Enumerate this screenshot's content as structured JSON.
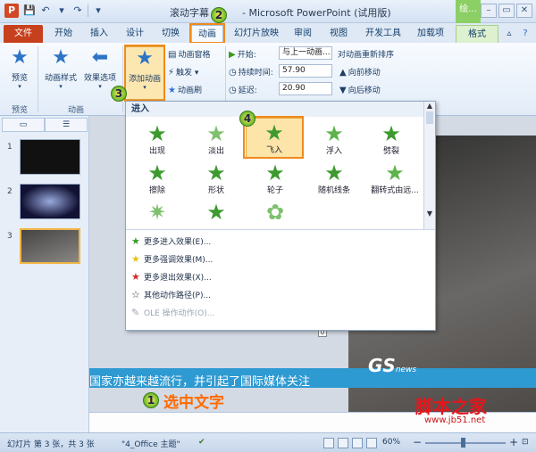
{
  "title_bar": {
    "file_name": "滚动字幕",
    "app_name": "- Microsoft PowerPoint (试用版)",
    "context_tab_group": "绘..."
  },
  "tabs": [
    "文件",
    "开始",
    "插入",
    "设计",
    "切换",
    "动画",
    "幻灯片放映",
    "审阅",
    "视图",
    "开发工具",
    "加载项",
    "格式"
  ],
  "ribbon": {
    "preview": {
      "label": "预览",
      "group": "预览"
    },
    "animation_styles": "动画样式",
    "effect_options": "效果选项",
    "animation_group": "动画",
    "add_animation": "添加动画",
    "animation_pane": "动画窗格",
    "trigger": "触发",
    "animation_painter": "动画刷",
    "start_label": "开始:",
    "start_value": "与上一动画...",
    "duration_label": "持续时间:",
    "duration_value": "57.90",
    "delay_label": "延迟:",
    "delay_value": "20.90",
    "reorder_title": "对动画重新排序",
    "move_earlier": "向前移动",
    "move_later": "向后移动"
  },
  "markers": [
    "1",
    "2",
    "3",
    "4"
  ],
  "gallery": {
    "header": "进入",
    "effects": [
      "出现",
      "淡出",
      "飞入",
      "浮入",
      "劈裂",
      "擦除",
      "形状",
      "轮子",
      "随机线条",
      "翻转式由远...",
      "",
      "",
      ""
    ],
    "selected_effect": "飞入",
    "menu": [
      {
        "label": "更多进入效果(E)...",
        "icon": "green-star-icon"
      },
      {
        "label": "更多强调效果(M)...",
        "icon": "yellow-star-icon"
      },
      {
        "label": "更多退出效果(X)...",
        "icon": "red-star-icon"
      },
      {
        "label": "其他动作路径(P)...",
        "icon": "outline-star-icon"
      },
      {
        "label": "OLE 操作动作(O)...",
        "icon": "ole-icon",
        "disabled": true
      }
    ]
  },
  "slide_panel": {
    "numbers": [
      "1",
      "2",
      "3"
    ]
  },
  "slide": {
    "logo": "GS",
    "logo_suffix": "news",
    "scroll_text": "国家亦越来越流行，并引起了国际媒体关注",
    "anim_tag": "0",
    "instruction": "选中文字"
  },
  "status_bar": {
    "slide_info": "幻灯片 第 3 张，共 3 张",
    "theme": "\"4_Office 主题\"",
    "zoom": "60%"
  },
  "watermark": {
    "brand": "脚本之家",
    "url": "www.jb51.net"
  }
}
